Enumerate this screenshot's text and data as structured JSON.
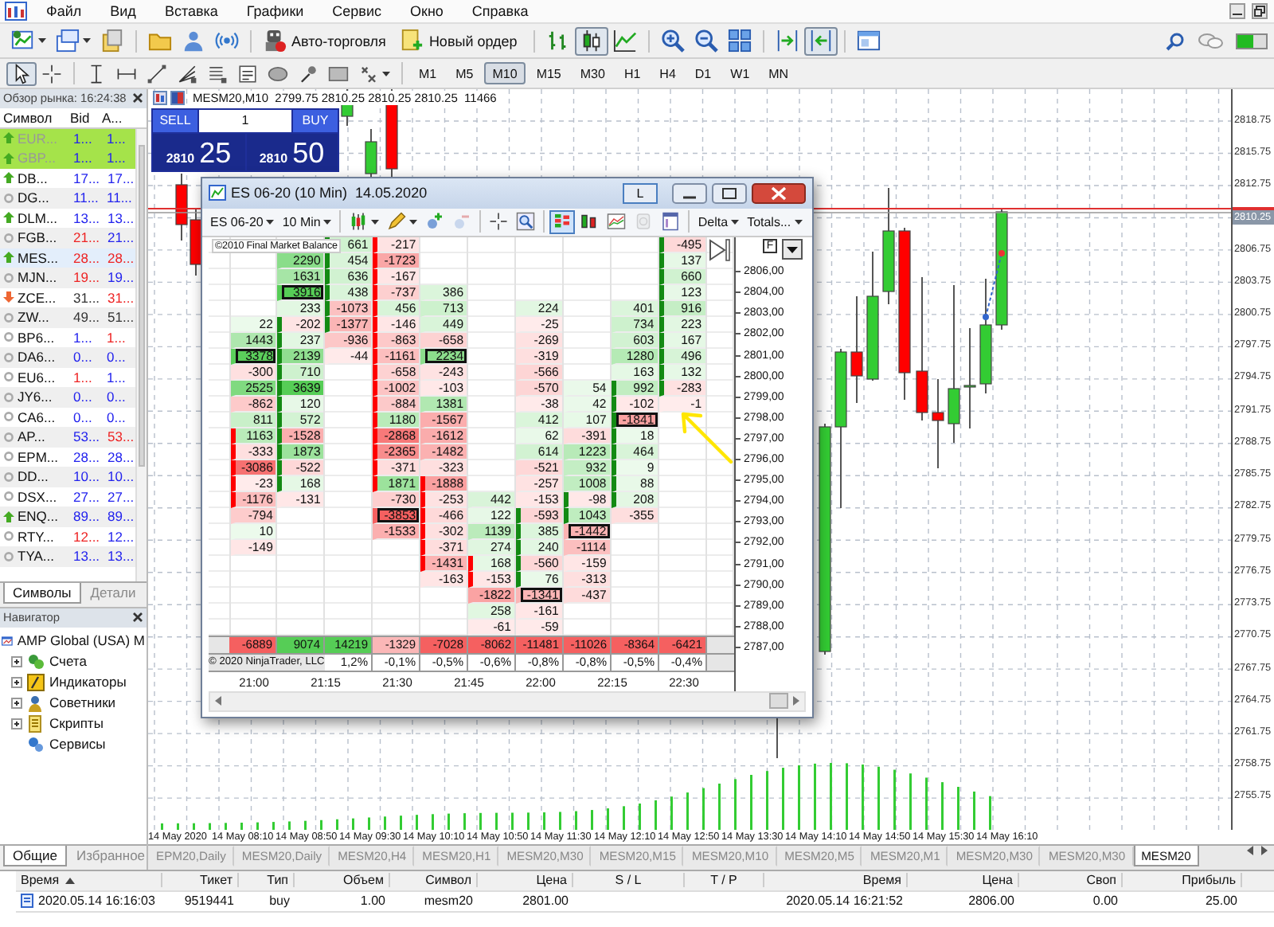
{
  "menu": [
    "Файл",
    "Вид",
    "Вставка",
    "Графики",
    "Сервис",
    "Окно",
    "Справка"
  ],
  "toolbar": [
    [
      {
        "kind": "new_chart",
        "selected": false
      },
      {
        "kind": "profiles",
        "selected": false
      },
      {
        "kind": "data_window",
        "selected": false
      }
    ],
    [
      {
        "kind": "navigator",
        "selected": false
      },
      {
        "kind": "terminal",
        "selected": false
      },
      {
        "kind": "signals",
        "selected": false
      }
    ],
    [
      {
        "kind": "auto_trading",
        "label": "Авто-торговля",
        "selected": false
      },
      {
        "kind": "new_order",
        "label": "Новый ордер",
        "selected": false
      }
    ],
    [
      {
        "kind": "bars",
        "selected": false
      },
      {
        "kind": "candles",
        "selected": true
      },
      {
        "kind": "line",
        "selected": false
      }
    ],
    [
      {
        "kind": "zoom_in",
        "selected": false
      },
      {
        "kind": "zoom_out",
        "selected": false
      },
      {
        "kind": "tile",
        "selected": false
      }
    ],
    [
      {
        "kind": "shift",
        "selected": false
      },
      {
        "kind": "autoscroll",
        "selected": true
      }
    ],
    [
      {
        "kind": "templates",
        "selected": false
      }
    ]
  ],
  "drawing_tools": [
    [
      {
        "kind": "cursor",
        "selected": true
      },
      {
        "kind": "crosshair",
        "selected": false
      }
    ],
    [
      {
        "kind": "vline",
        "selected": false
      },
      {
        "kind": "hline",
        "selected": false
      },
      {
        "kind": "trend",
        "selected": false
      },
      {
        "kind": "fan",
        "selected": false
      },
      {
        "kind": "levels",
        "selected": false
      },
      {
        "kind": "text_box",
        "selected": false
      },
      {
        "kind": "oval",
        "selected": false
      },
      {
        "kind": "pin",
        "selected": false
      },
      {
        "kind": "rect",
        "selected": false
      },
      {
        "kind": "shapes",
        "selected": false
      }
    ]
  ],
  "timeframes": [
    {
      "label": "M1",
      "selected": false
    },
    {
      "label": "M5",
      "selected": false
    },
    {
      "label": "M10",
      "selected": true
    },
    {
      "label": "M15",
      "selected": false
    },
    {
      "label": "M30",
      "selected": false
    },
    {
      "label": "H1",
      "selected": false
    },
    {
      "label": "H4",
      "selected": false
    },
    {
      "label": "D1",
      "selected": false
    },
    {
      "label": "W1",
      "selected": false
    },
    {
      "label": "MN",
      "selected": false
    }
  ],
  "market_watch": {
    "title": "Обзор рынка: 16:24:38",
    "columns": [
      "Символ",
      "Bid",
      "A..."
    ],
    "rows": [
      {
        "symbol": "EUR...",
        "kind": "up",
        "bid": {
          "text": "1...",
          "color": "#2222ee"
        },
        "ask": {
          "text": "1...",
          "color": "#2222ee"
        },
        "highlighted": true,
        "selected": false
      },
      {
        "symbol": "GBP...",
        "kind": "up",
        "bid": {
          "text": "1...",
          "color": "#2222ee"
        },
        "ask": {
          "text": "1...",
          "color": "#2222ee"
        },
        "highlighted": true,
        "selected": false
      },
      {
        "symbol": "DB...",
        "kind": "up",
        "bid": {
          "text": "17...",
          "color": "#2222ee"
        },
        "ask": {
          "text": "17...",
          "color": "#2222ee"
        },
        "highlighted": false,
        "selected": false
      },
      {
        "symbol": "DG...",
        "kind": "flat",
        "bid": {
          "text": "11...",
          "color": "#2222ee"
        },
        "ask": {
          "text": "11...",
          "color": "#2222ee"
        },
        "highlighted": false,
        "selected": false
      },
      {
        "symbol": "DLM...",
        "kind": "up",
        "bid": {
          "text": "13...",
          "color": "#2222ee"
        },
        "ask": {
          "text": "13...",
          "color": "#2222ee"
        },
        "highlighted": false,
        "selected": false
      },
      {
        "symbol": "FGB...",
        "kind": "flat",
        "bid": {
          "text": "21...",
          "color": "#ee2222"
        },
        "ask": {
          "text": "21...",
          "color": "#2222ee"
        },
        "highlighted": false,
        "selected": false
      },
      {
        "symbol": "MES...",
        "kind": "up",
        "bid": {
          "text": "28...",
          "color": "#ee2222"
        },
        "ask": {
          "text": "28...",
          "color": "#ee2222"
        },
        "highlighted": false,
        "selected": true
      },
      {
        "symbol": "MJN...",
        "kind": "flat",
        "bid": {
          "text": "19...",
          "color": "#ee2222"
        },
        "ask": {
          "text": "19...",
          "color": "#2222ee"
        },
        "highlighted": false,
        "selected": false
      },
      {
        "symbol": "ZCE...",
        "kind": "down",
        "bid": {
          "text": "31...",
          "color": "#333333"
        },
        "ask": {
          "text": "31...",
          "color": "#ee2222"
        },
        "highlighted": false,
        "selected": false
      },
      {
        "symbol": "ZW...",
        "kind": "flat",
        "bid": {
          "text": "49...",
          "color": "#333333"
        },
        "ask": {
          "text": "51...",
          "color": "#333333"
        },
        "highlighted": false,
        "selected": false
      },
      {
        "symbol": "BP6...",
        "kind": "flat",
        "bid": {
          "text": "1...",
          "color": "#2222ee"
        },
        "ask": {
          "text": "1...",
          "color": "#ee2222"
        },
        "highlighted": false,
        "selected": false
      },
      {
        "symbol": "DA6...",
        "kind": "flat",
        "bid": {
          "text": "0...",
          "color": "#2222ee"
        },
        "ask": {
          "text": "0...",
          "color": "#2222ee"
        },
        "highlighted": false,
        "selected": false
      },
      {
        "symbol": "EU6...",
        "kind": "flat",
        "bid": {
          "text": "1...",
          "color": "#ee2222"
        },
        "ask": {
          "text": "1...",
          "color": "#2222ee"
        },
        "highlighted": false,
        "selected": false
      },
      {
        "symbol": "JY6...",
        "kind": "flat",
        "bid": {
          "text": "0...",
          "color": "#2222ee"
        },
        "ask": {
          "text": "0...",
          "color": "#2222ee"
        },
        "highlighted": false,
        "selected": false
      },
      {
        "symbol": "CA6...",
        "kind": "flat",
        "bid": {
          "text": "0...",
          "color": "#2222ee"
        },
        "ask": {
          "text": "0...",
          "color": "#2222ee"
        },
        "highlighted": false,
        "selected": false
      },
      {
        "symbol": "AP...",
        "kind": "flat",
        "bid": {
          "text": "53...",
          "color": "#2222ee"
        },
        "ask": {
          "text": "53...",
          "color": "#ee2222"
        },
        "highlighted": false,
        "selected": false
      },
      {
        "symbol": "EPM...",
        "kind": "flat",
        "bid": {
          "text": "28...",
          "color": "#2222ee"
        },
        "ask": {
          "text": "28...",
          "color": "#2222ee"
        },
        "highlighted": false,
        "selected": false
      },
      {
        "symbol": "DD...",
        "kind": "flat",
        "bid": {
          "text": "10...",
          "color": "#2222ee"
        },
        "ask": {
          "text": "10...",
          "color": "#2222ee"
        },
        "highlighted": false,
        "selected": false
      },
      {
        "symbol": "DSX...",
        "kind": "flat",
        "bid": {
          "text": "27...",
          "color": "#2222ee"
        },
        "ask": {
          "text": "27...",
          "color": "#2222ee"
        },
        "highlighted": false,
        "selected": false
      },
      {
        "symbol": "ENQ...",
        "kind": "up",
        "bid": {
          "text": "89...",
          "color": "#2222ee"
        },
        "ask": {
          "text": "89...",
          "color": "#2222ee"
        },
        "highlighted": false,
        "selected": false
      },
      {
        "symbol": "RTY...",
        "kind": "flat",
        "bid": {
          "text": "12...",
          "color": "#ee2222"
        },
        "ask": {
          "text": "12...",
          "color": "#2222ee"
        },
        "highlighted": false,
        "selected": false
      },
      {
        "symbol": "TYA...",
        "kind": "flat",
        "bid": {
          "text": "13...",
          "color": "#2222ee"
        },
        "ask": {
          "text": "13...",
          "color": "#2222ee"
        },
        "highlighted": false,
        "selected": false
      }
    ],
    "tabs": [
      {
        "label": "Символы",
        "selected": true
      },
      {
        "label": "Детали",
        "selected": false
      }
    ]
  },
  "navigator": {
    "title": "Навигатор",
    "tree": [
      {
        "label": "AMP Global (USA) M",
        "kind": "broker",
        "children": [
          {
            "label": "Счета",
            "kind": "accounts",
            "expanded": false,
            "has_children": true
          },
          {
            "label": "Индикаторы",
            "kind": "indicators",
            "expanded": false,
            "has_children": true
          },
          {
            "label": "Советники",
            "kind": "experts",
            "expanded": false,
            "has_children": true
          },
          {
            "label": "Скрипты",
            "kind": "scripts",
            "expanded": false,
            "has_children": true
          },
          {
            "label": "Сервисы",
            "kind": "services",
            "has_children": false
          }
        ]
      }
    ],
    "tabs": [
      {
        "label": "Общие",
        "selected": true
      },
      {
        "label": "Избранное",
        "selected": false
      }
    ]
  },
  "chart": {
    "header": "MESM20,M10  2799.75 2810.25 2810.25 2810.25  11466",
    "one_click": {
      "sell": "SELL",
      "volume": "1",
      "buy": "BUY",
      "bid_base": "2810",
      "bid_pips": "25",
      "ask_base": "2810",
      "ask_pips": "50"
    },
    "price_axis": [
      {
        "label": "2818.75",
        "kind": "tick"
      },
      {
        "label": "2815.75",
        "kind": "tick"
      },
      {
        "label": "2812.75",
        "kind": "tick"
      },
      {
        "label": "2810.25",
        "kind": "current"
      },
      {
        "label": "2806.75",
        "kind": "tick"
      },
      {
        "label": "2803.75",
        "kind": "tick"
      },
      {
        "label": "2800.75",
        "kind": "tick"
      },
      {
        "label": "2797.75",
        "kind": "tick"
      },
      {
        "label": "2794.75",
        "kind": "tick"
      },
      {
        "label": "2791.75",
        "kind": "tick"
      },
      {
        "label": "2788.75",
        "kind": "tick"
      },
      {
        "label": "2785.75",
        "kind": "tick"
      },
      {
        "label": "2782.75",
        "kind": "tick"
      },
      {
        "label": "2779.75",
        "kind": "tick"
      },
      {
        "label": "2776.75",
        "kind": "tick"
      },
      {
        "label": "2773.75",
        "kind": "tick"
      },
      {
        "label": "2770.75",
        "kind": "tick"
      },
      {
        "label": "2767.75",
        "kind": "tick"
      },
      {
        "label": "2764.75",
        "kind": "tick"
      },
      {
        "label": "2761.75",
        "kind": "tick"
      },
      {
        "label": "2758.75",
        "kind": "tick"
      },
      {
        "label": "2755.75",
        "kind": "tick"
      }
    ],
    "time_axis": [
      "14 May 2020",
      "14 May 08:10",
      "14 May 08:50",
      "14 May 09:30",
      "14 May 10:10",
      "14 May 10:50",
      "14 May 11:30",
      "14 May 12:10",
      "14 May 12:50",
      "14 May 13:30",
      "14 May 14:10",
      "14 May 14:50",
      "14 May 15:30",
      "14 May 16:10"
    ],
    "tabs": [
      {
        "label": "EPM20,Daily",
        "selected": false
      },
      {
        "label": "MESM20,Daily",
        "selected": false
      },
      {
        "label": "MESM20,H4",
        "selected": false
      },
      {
        "label": "MESM20,H1",
        "selected": false
      },
      {
        "label": "MESM20,M30",
        "selected": false
      },
      {
        "label": "MESM20,M15",
        "selected": false
      },
      {
        "label": "MESM20,M10",
        "selected": false
      },
      {
        "label": "MESM20,M5",
        "selected": false
      },
      {
        "label": "MESM20,M1",
        "selected": false
      },
      {
        "label": "MESM20,M30",
        "selected": false
      },
      {
        "label": "MESM20,M30",
        "selected": false
      },
      {
        "label": "MESM20",
        "selected": true
      }
    ]
  },
  "footprint": {
    "title": "ES 06-20 (10 Min)  14.05.2020",
    "lock_button": "L",
    "toolbar": [
      {
        "kind": "instrument",
        "label": "ES 06-20",
        "selected": false,
        "disabled": false
      },
      {
        "kind": "period",
        "label": "10 Min",
        "selected": false,
        "disabled": false
      },
      {
        "kind": "chart_style",
        "selected": false,
        "disabled": false
      },
      {
        "kind": "draw",
        "selected": false,
        "disabled": false
      },
      {
        "kind": "marker_add",
        "selected": false,
        "disabled": false
      },
      {
        "kind": "marker_remove",
        "selected": false,
        "disabled": true
      },
      {
        "kind": "crosshair",
        "selected": false,
        "disabled": false
      },
      {
        "kind": "zoom_box",
        "selected": false,
        "disabled": false
      },
      {
        "kind": "footprint",
        "selected": true,
        "disabled": false
      },
      {
        "kind": "bars_view",
        "selected": false,
        "disabled": false
      },
      {
        "kind": "chart_view",
        "selected": false,
        "disabled": false
      },
      {
        "kind": "coin",
        "selected": false,
        "disabled": true
      },
      {
        "kind": "panel_view",
        "selected": false,
        "disabled": false
      },
      {
        "kind": "indicator",
        "label": "Delta",
        "selected": false,
        "disabled": false
      },
      {
        "kind": "totals",
        "label": "Totals...",
        "selected": false,
        "disabled": false
      }
    ],
    "badge": "©2010 Final Market Balance",
    "f_button": "F",
    "columns": [
      {
        "kind": "down",
        "total": "-6889",
        "cells": [
          null,
          null,
          null,
          null,
          null,
          {
            "v": "22",
            "body": false,
            "boxed": false
          },
          {
            "v": "1443",
            "body": false,
            "boxed": false
          },
          {
            "v": "3378",
            "body": false,
            "boxed": true
          },
          {
            "v": "-300",
            "body": false,
            "boxed": false
          },
          {
            "v": "2525",
            "body": false,
            "boxed": false
          },
          {
            "v": "-862",
            "body": false,
            "boxed": false
          },
          {
            "v": "811",
            "body": false,
            "boxed": false
          },
          {
            "v": "1163",
            "body": true,
            "boxed": false
          },
          {
            "v": "-333",
            "body": true,
            "boxed": false
          },
          {
            "v": "-3086",
            "body": true,
            "boxed": false
          },
          {
            "v": "-23",
            "body": true,
            "boxed": false
          },
          {
            "v": "-1176",
            "body": true,
            "boxed": false
          },
          {
            "v": "-794",
            "body": false,
            "boxed": false
          },
          {
            "v": "10",
            "body": false,
            "boxed": false
          },
          {
            "v": "-149",
            "body": false,
            "boxed": false
          },
          null,
          null,
          null,
          null,
          null
        ]
      },
      {
        "kind": "up",
        "total": "9074",
        "cells": [
          null,
          {
            "v": "2290",
            "body": false,
            "boxed": false
          },
          {
            "v": "1631",
            "body": false,
            "boxed": false
          },
          {
            "v": "3916",
            "body": false,
            "boxed": true
          },
          {
            "v": "233",
            "body": false,
            "boxed": false
          },
          {
            "v": "-202",
            "body": true,
            "boxed": false
          },
          {
            "v": "237",
            "body": true,
            "boxed": false
          },
          {
            "v": "2139",
            "body": true,
            "boxed": false
          },
          {
            "v": "710",
            "body": true,
            "boxed": false
          },
          {
            "v": "3639",
            "body": true,
            "boxed": false
          },
          {
            "v": "120",
            "body": true,
            "boxed": false
          },
          {
            "v": "572",
            "body": true,
            "boxed": false
          },
          {
            "v": "-1528",
            "body": true,
            "boxed": false
          },
          {
            "v": "1873",
            "body": true,
            "boxed": false
          },
          {
            "v": "-522",
            "body": true,
            "boxed": false
          },
          {
            "v": "168",
            "body": true,
            "boxed": false
          },
          {
            "v": "-131",
            "body": false,
            "boxed": false
          },
          null,
          null,
          null,
          null,
          null,
          null,
          null,
          null
        ]
      },
      {
        "kind": "up",
        "total": "14219",
        "percent": "1,2%",
        "cells": [
          {
            "v": "661",
            "body": true,
            "boxed": false
          },
          {
            "v": "454",
            "body": true,
            "boxed": false
          },
          {
            "v": "636",
            "body": true,
            "boxed": false
          },
          {
            "v": "438",
            "body": true,
            "boxed": false
          },
          {
            "v": "-1073",
            "body": true,
            "boxed": false
          },
          {
            "v": "-1377",
            "body": true,
            "boxed": false
          },
          {
            "v": "-936",
            "body": false,
            "boxed": false
          },
          {
            "v": "-44",
            "body": false,
            "boxed": false
          },
          null,
          null,
          null,
          null,
          null,
          null,
          null,
          null,
          null,
          null,
          null,
          null,
          null,
          null,
          null,
          null,
          null
        ]
      },
      {
        "kind": "down",
        "total": "-1329",
        "percent": "-0,1%",
        "cells": [
          {
            "v": "-217",
            "body": true,
            "boxed": false
          },
          {
            "v": "-1723",
            "body": true,
            "boxed": false
          },
          {
            "v": "-167",
            "body": true,
            "boxed": false
          },
          {
            "v": "-737",
            "body": true,
            "boxed": false
          },
          {
            "v": "456",
            "body": true,
            "boxed": false
          },
          {
            "v": "-146",
            "body": true,
            "boxed": false
          },
          {
            "v": "-863",
            "body": true,
            "boxed": false
          },
          {
            "v": "-1161",
            "body": true,
            "boxed": false
          },
          {
            "v": "-658",
            "body": true,
            "boxed": false
          },
          {
            "v": "-1002",
            "body": true,
            "boxed": false
          },
          {
            "v": "-884",
            "body": true,
            "boxed": false
          },
          {
            "v": "1180",
            "body": true,
            "boxed": false
          },
          {
            "v": "-2868",
            "body": true,
            "boxed": false
          },
          {
            "v": "-2365",
            "body": true,
            "boxed": false
          },
          {
            "v": "-371",
            "body": true,
            "boxed": false
          },
          {
            "v": "1871",
            "body": true,
            "boxed": false
          },
          {
            "v": "-730",
            "body": false,
            "boxed": false
          },
          {
            "v": "-3853",
            "body": false,
            "boxed": true
          },
          {
            "v": "-1533",
            "body": false,
            "boxed": false
          },
          null,
          null,
          null,
          null,
          null,
          null
        ]
      },
      {
        "kind": "down",
        "total": "-7028",
        "percent": "-0,5%",
        "cells": [
          null,
          null,
          null,
          {
            "v": "386",
            "body": false,
            "boxed": false
          },
          {
            "v": "713",
            "body": false,
            "boxed": false
          },
          {
            "v": "449",
            "body": false,
            "boxed": false
          },
          {
            "v": "-658",
            "body": false,
            "boxed": false
          },
          {
            "v": "2234",
            "body": false,
            "boxed": true
          },
          {
            "v": "-243",
            "body": false,
            "boxed": false
          },
          {
            "v": "-103",
            "body": false,
            "boxed": false
          },
          {
            "v": "1381",
            "body": false,
            "boxed": false
          },
          {
            "v": "-1567",
            "body": false,
            "boxed": false
          },
          {
            "v": "-1612",
            "body": false,
            "boxed": false
          },
          {
            "v": "-1482",
            "body": false,
            "boxed": false
          },
          {
            "v": "-323",
            "body": false,
            "boxed": false
          },
          {
            "v": "-1888",
            "body": true,
            "boxed": false
          },
          {
            "v": "-253",
            "body": true,
            "boxed": false
          },
          {
            "v": "-466",
            "body": true,
            "boxed": false
          },
          {
            "v": "-302",
            "body": true,
            "boxed": false
          },
          {
            "v": "-371",
            "body": true,
            "boxed": false
          },
          {
            "v": "-1431",
            "body": true,
            "boxed": false
          },
          {
            "v": "-163",
            "body": false,
            "boxed": false
          },
          null,
          null,
          null
        ]
      },
      {
        "kind": "down",
        "total": "-8062",
        "percent": "-0,6%",
        "cells": [
          null,
          null,
          null,
          null,
          null,
          null,
          null,
          null,
          null,
          null,
          null,
          null,
          null,
          null,
          null,
          null,
          {
            "v": "442",
            "body": false,
            "boxed": false
          },
          {
            "v": "122",
            "body": false,
            "boxed": false
          },
          {
            "v": "1139",
            "body": false,
            "boxed": false
          },
          {
            "v": "274",
            "body": false,
            "boxed": false
          },
          {
            "v": "168",
            "body": true,
            "boxed": false
          },
          {
            "v": "-153",
            "body": true,
            "boxed": false
          },
          {
            "v": "-1822",
            "body": false,
            "boxed": false
          },
          {
            "v": "258",
            "body": false,
            "boxed": false
          },
          {
            "v": "-61",
            "body": false,
            "boxed": false
          }
        ]
      },
      {
        "kind": "up",
        "total": "-11481",
        "percent": "-0,8%",
        "cells": [
          null,
          null,
          null,
          null,
          {
            "v": "224",
            "body": false,
            "boxed": false
          },
          {
            "v": "-25",
            "body": false,
            "boxed": false
          },
          {
            "v": "-269",
            "body": false,
            "boxed": false
          },
          {
            "v": "-319",
            "body": false,
            "boxed": false
          },
          {
            "v": "-566",
            "body": false,
            "boxed": false
          },
          {
            "v": "-570",
            "body": false,
            "boxed": false
          },
          {
            "v": "-38",
            "body": false,
            "boxed": false
          },
          {
            "v": "412",
            "body": false,
            "boxed": false
          },
          {
            "v": "62",
            "body": false,
            "boxed": false
          },
          {
            "v": "614",
            "body": false,
            "boxed": false
          },
          {
            "v": "-521",
            "body": false,
            "boxed": false
          },
          {
            "v": "-257",
            "body": false,
            "boxed": false
          },
          {
            "v": "-153",
            "body": false,
            "boxed": false
          },
          {
            "v": "-593",
            "body": true,
            "boxed": false
          },
          {
            "v": "385",
            "body": true,
            "boxed": false
          },
          {
            "v": "240",
            "body": true,
            "boxed": false
          },
          {
            "v": "-560",
            "body": true,
            "boxed": false
          },
          {
            "v": "76",
            "body": true,
            "boxed": false
          },
          {
            "v": "-1341",
            "body": false,
            "boxed": true
          },
          {
            "v": "-161",
            "body": false,
            "boxed": false
          },
          {
            "v": "-59",
            "body": false,
            "boxed": false
          }
        ]
      },
      {
        "kind": "up",
        "total": "-11026",
        "percent": "-0,8%",
        "cells": [
          null,
          null,
          null,
          null,
          null,
          null,
          null,
          null,
          null,
          {
            "v": "54",
            "body": false,
            "boxed": false
          },
          {
            "v": "42",
            "body": false,
            "boxed": false
          },
          {
            "v": "107",
            "body": false,
            "boxed": false
          },
          {
            "v": "-391",
            "body": false,
            "boxed": false
          },
          {
            "v": "1223",
            "body": false,
            "boxed": false
          },
          {
            "v": "932",
            "body": false,
            "boxed": false
          },
          {
            "v": "1008",
            "body": false,
            "boxed": false
          },
          {
            "v": "-98",
            "body": true,
            "boxed": false
          },
          {
            "v": "1043",
            "body": true,
            "boxed": false
          },
          {
            "v": "-1442",
            "body": false,
            "boxed": true
          },
          {
            "v": "-1114",
            "body": false,
            "boxed": false
          },
          {
            "v": "-159",
            "body": false,
            "boxed": false
          },
          {
            "v": "-313",
            "body": false,
            "boxed": false
          },
          {
            "v": "-437",
            "body": false,
            "boxed": false
          },
          null,
          null
        ]
      },
      {
        "kind": "up",
        "total": "-8364",
        "percent": "-0,5%",
        "cells": [
          null,
          null,
          null,
          null,
          {
            "v": "401",
            "body": false,
            "boxed": false
          },
          {
            "v": "734",
            "body": false,
            "boxed": false
          },
          {
            "v": "603",
            "body": false,
            "boxed": false
          },
          {
            "v": "1280",
            "body": false,
            "boxed": false
          },
          {
            "v": "163",
            "body": false,
            "boxed": false
          },
          {
            "v": "992",
            "body": true,
            "boxed": false
          },
          {
            "v": "-102",
            "body": true,
            "boxed": false
          },
          {
            "v": "-1841",
            "body": true,
            "boxed": true
          },
          {
            "v": "18",
            "body": true,
            "boxed": false
          },
          {
            "v": "464",
            "body": true,
            "boxed": false
          },
          {
            "v": "9",
            "body": true,
            "boxed": false
          },
          {
            "v": "88",
            "body": true,
            "boxed": false
          },
          {
            "v": "208",
            "body": true,
            "boxed": false
          },
          {
            "v": "-355",
            "body": false,
            "boxed": false
          },
          null,
          null,
          null,
          null,
          null,
          null,
          null
        ]
      },
      {
        "kind": "up",
        "total": "-6421",
        "percent": "-0,4%",
        "cells": [
          {
            "v": "-495",
            "body": true,
            "boxed": false
          },
          {
            "v": "137",
            "body": true,
            "boxed": false
          },
          {
            "v": "660",
            "body": true,
            "boxed": false
          },
          {
            "v": "123",
            "body": true,
            "boxed": false
          },
          {
            "v": "916",
            "body": true,
            "boxed": false
          },
          {
            "v": "223",
            "body": true,
            "boxed": false
          },
          {
            "v": "167",
            "body": true,
            "boxed": false
          },
          {
            "v": "496",
            "body": true,
            "boxed": false
          },
          {
            "v": "132",
            "body": true,
            "boxed": false
          },
          {
            "v": "-283",
            "body": true,
            "boxed": false
          },
          {
            "v": "-1",
            "body": false,
            "boxed": false
          },
          null,
          null,
          null,
          null,
          null,
          null,
          null,
          null,
          null,
          null,
          null,
          null,
          null,
          null
        ]
      }
    ],
    "copyright": "© 2020 NinjaTrader, LLC",
    "price_axis": [
      "2806,00",
      "2804,00",
      "2803,00",
      "2802,00",
      "2801,00",
      "2800,00",
      "2799,00",
      "2798,00",
      "2797,00",
      "2796,00",
      "2795,00",
      "2794,00",
      "2793,00",
      "2792,00",
      "2791,00",
      "2790,00",
      "2789,00",
      "2788,00",
      "2787,00"
    ],
    "time_labels": [
      "21:00",
      "21:15",
      "21:30",
      "21:45",
      "22:00",
      "22:15",
      "22:30"
    ]
  },
  "terminal": {
    "rows": [
      {
        "kind": "position"
      }
    ],
    "columns": [
      {
        "label": "Время",
        "sorted": true,
        "values": [
          "2020.05.14 16:16:03"
        ]
      },
      {
        "label": "Тикет",
        "sorted": false,
        "values": [
          "9519441"
        ]
      },
      {
        "label": "Тип",
        "sorted": false,
        "values": [
          "buy"
        ]
      },
      {
        "label": "Объем",
        "sorted": false,
        "values": [
          "1.00"
        ]
      },
      {
        "label": "Символ",
        "sorted": false,
        "values": [
          "mesm20"
        ]
      },
      {
        "label": "Цена",
        "sorted": false,
        "values": [
          "2801.00"
        ]
      },
      {
        "label": "S / L",
        "sorted": false
      },
      {
        "label": "T / P",
        "sorted": false
      },
      {
        "label": "Время",
        "sorted": false,
        "values": [
          "2020.05.14 16:21:52"
        ]
      },
      {
        "label": "Цена",
        "sorted": false,
        "values": [
          "2806.00"
        ]
      },
      {
        "label": "Своп",
        "sorted": false,
        "values": [
          "0.00"
        ]
      },
      {
        "label": "Прибыль",
        "sorted": false,
        "values": [
          "25.00"
        ]
      }
    ]
  }
}
